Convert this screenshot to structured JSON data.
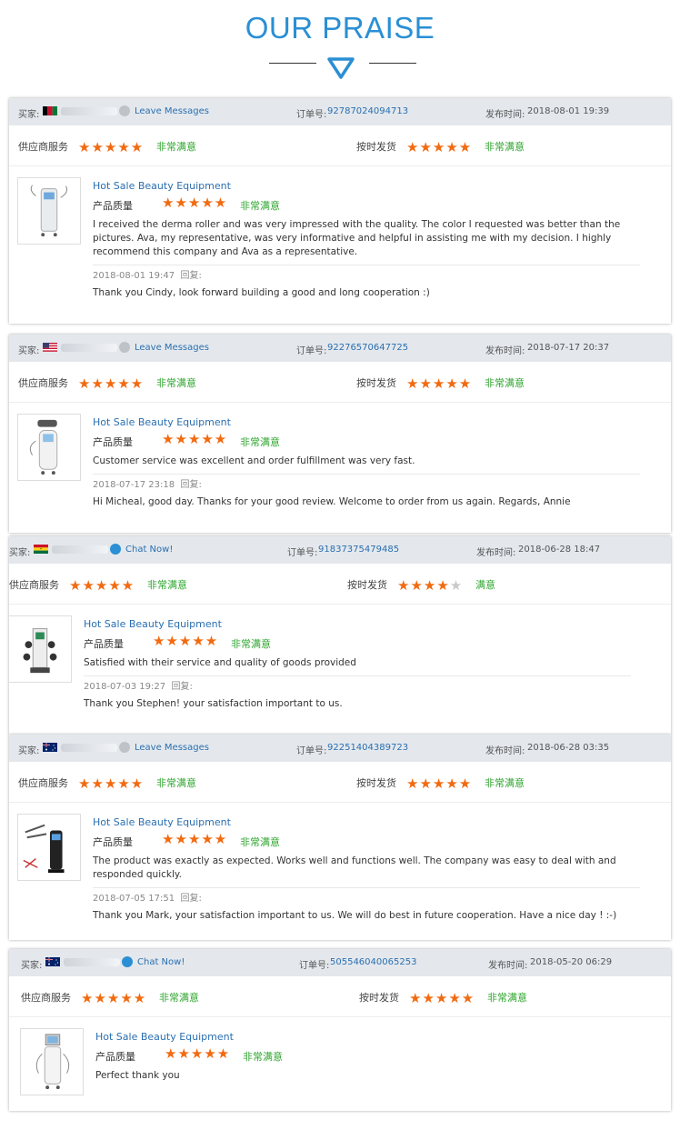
{
  "header": {
    "title": "OUR PRAISE"
  },
  "labels": {
    "buyer": "买家:",
    "order": "订单号:",
    "time": "发布时间:",
    "supplier_service": "供应商服务",
    "on_time": "按时发货",
    "quality": "产品质量",
    "reply": "回复:"
  },
  "colors": {
    "accent": "#2a8fd4",
    "star": "#f26a10",
    "satisfied": "#2fa52f",
    "bar": "#e4e8ed"
  },
  "reviews": [
    {
      "flag": "afghanistan",
      "message_action": "Leave Messages",
      "order_no": "92787024094713",
      "posted": "2018-08-01 19:39",
      "supplier_stars": 5,
      "supplier_text": "非常满意",
      "delivery_stars": 5,
      "delivery_text": "非常满意",
      "product": "Hot Sale Beauty Equipment",
      "quality_stars": 5,
      "quality_text": "非常满意",
      "text": "I received the derma roller and was very impressed with the quality. The color I requested was better than the pictures. Ava, my representative, was very informative and helpful in assisting me with my decision. I highly recommend this company and Ava as a representative.",
      "reply_date": "2018-08-01 19:47",
      "reply": "Thank you Cindy, look forward building a good and long cooperation :)"
    },
    {
      "flag": "usa",
      "message_action": "Leave Messages",
      "order_no": "92276570647725",
      "posted": "2018-07-17 20:37",
      "supplier_stars": 5,
      "supplier_text": "非常满意",
      "delivery_stars": 5,
      "delivery_text": "非常满意",
      "product": "Hot Sale Beauty Equipment",
      "quality_stars": 5,
      "quality_text": "非常满意",
      "text": "Customer service was excellent and order fulfillment was very fast.",
      "reply_date": "2018-07-17 23:18",
      "reply": "Hi Micheal, good day. Thanks for your good review. Welcome to order from us again. Regards, Annie"
    },
    {
      "flag": "ghana",
      "message_action": "Chat Now!",
      "order_no": "91837375479485",
      "posted": "2018-06-28 18:47",
      "supplier_stars": 5,
      "supplier_text": "非常满意",
      "delivery_stars": 4,
      "delivery_text": "满意",
      "product": "Hot Sale Beauty Equipment",
      "quality_stars": 5,
      "quality_text": "非常满意",
      "text": "Satisfied with their service and quality of goods provided",
      "reply_date": "2018-07-03 19:27",
      "reply": "Thank you Stephen! your satisfaction important to us."
    },
    {
      "flag": "australia",
      "message_action": "Leave Messages",
      "order_no": "92251404389723",
      "posted": "2018-06-28 03:35",
      "supplier_stars": 5,
      "supplier_text": "非常满意",
      "delivery_stars": 5,
      "delivery_text": "非常满意",
      "product": "Hot Sale Beauty Equipment",
      "quality_stars": 5,
      "quality_text": "非常满意",
      "text": "The product was exactly as expected. Works well and functions well. The company was easy to deal with and responded quickly.",
      "reply_date": "2018-07-05 17:51",
      "reply": "Thank you Mark, your satisfaction important to us. We will do best in future cooperation. Have a nice day ! :-)"
    },
    {
      "flag": "australia",
      "message_action": "Chat Now!",
      "order_no": "505546040065253",
      "posted": "2018-05-20 06:29",
      "supplier_stars": 5,
      "supplier_text": "非常满意",
      "delivery_stars": 5,
      "delivery_text": "非常满意",
      "product": "Hot Sale Beauty Equipment",
      "quality_stars": 5,
      "quality_text": "非常满意",
      "text": "Perfect thank you"
    }
  ]
}
